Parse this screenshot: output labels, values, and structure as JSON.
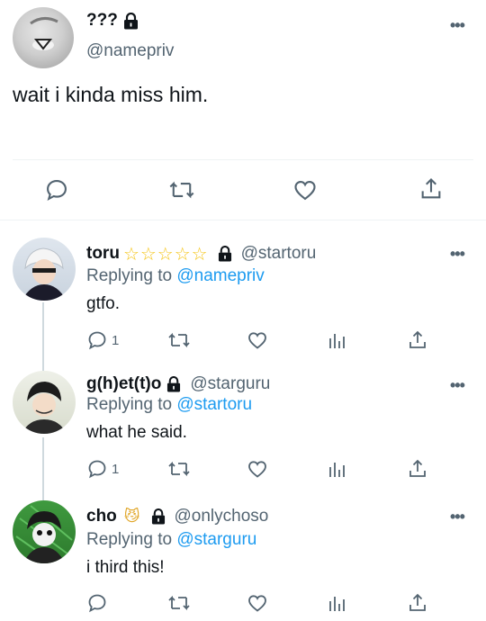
{
  "main_tweet": {
    "display_name": "???",
    "handle": "@namepriv",
    "text": "wait i kinda miss him.",
    "more_label": "•••"
  },
  "replies": [
    {
      "display_name": "toru",
      "stars": "☆☆☆☆☆",
      "handle": "@startoru",
      "replying_prefix": "Replying to ",
      "replying_to": "@namepriv",
      "text": "gtfo.",
      "reply_count": "1",
      "more_label": "•••"
    },
    {
      "display_name": "g(h)et(t)o",
      "handle": "@starguru",
      "replying_prefix": "Replying to ",
      "replying_to": "@startoru",
      "text": "what he said.",
      "reply_count": "1",
      "more_label": "•••"
    },
    {
      "display_name": "cho",
      "emoji": "😼",
      "handle": "@onlychoso",
      "replying_prefix": "Replying to ",
      "replying_to": "@starguru",
      "text": "i third this!",
      "reply_count": "",
      "more_label": "•••"
    }
  ],
  "colors": {
    "accent": "#1d9bf0",
    "secondary_text": "#536471",
    "icon": "#536471",
    "divider": "#eff3f4",
    "star": "#f5c518"
  },
  "icons": [
    "lock-icon",
    "reply-icon",
    "retweet-icon",
    "like-icon",
    "views-icon",
    "share-icon",
    "more-icon",
    "star-icon"
  ]
}
